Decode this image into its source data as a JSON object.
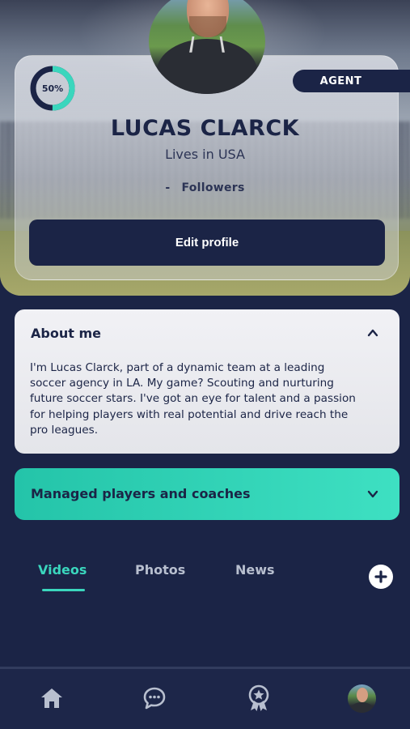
{
  "profile": {
    "completion_label": "50%",
    "completion": 0.5,
    "role": "AGENT",
    "name": "LUCAS CLARCK",
    "location": "Lives in USA",
    "followers_count": "-",
    "followers_label": "Followers",
    "edit_button": "Edit profile"
  },
  "about": {
    "title": "About me",
    "expanded": true,
    "lines": [
      "I'm Lucas Clarck, part of a dynamic team at a leading",
      "soccer agency in LA. My game? Scouting and nurturing",
      "future soccer stars. I've got an eye for talent and a passion",
      "for helping players with real potential and drive reach the",
      "pro leagues."
    ]
  },
  "managed": {
    "title": "Managed players and coaches",
    "expanded": false
  },
  "tabs": [
    {
      "label": "Videos",
      "active": true
    },
    {
      "label": "Photos",
      "active": false
    },
    {
      "label": "News",
      "active": false
    }
  ],
  "icons": {
    "add": "plus-circle-icon",
    "nav": [
      "home-icon",
      "chat-icon",
      "award-icon",
      "profile-avatar"
    ]
  },
  "colors": {
    "navy": "#1b2446",
    "accent": "#3ad6bd",
    "card_light": "#f1f1f5"
  }
}
